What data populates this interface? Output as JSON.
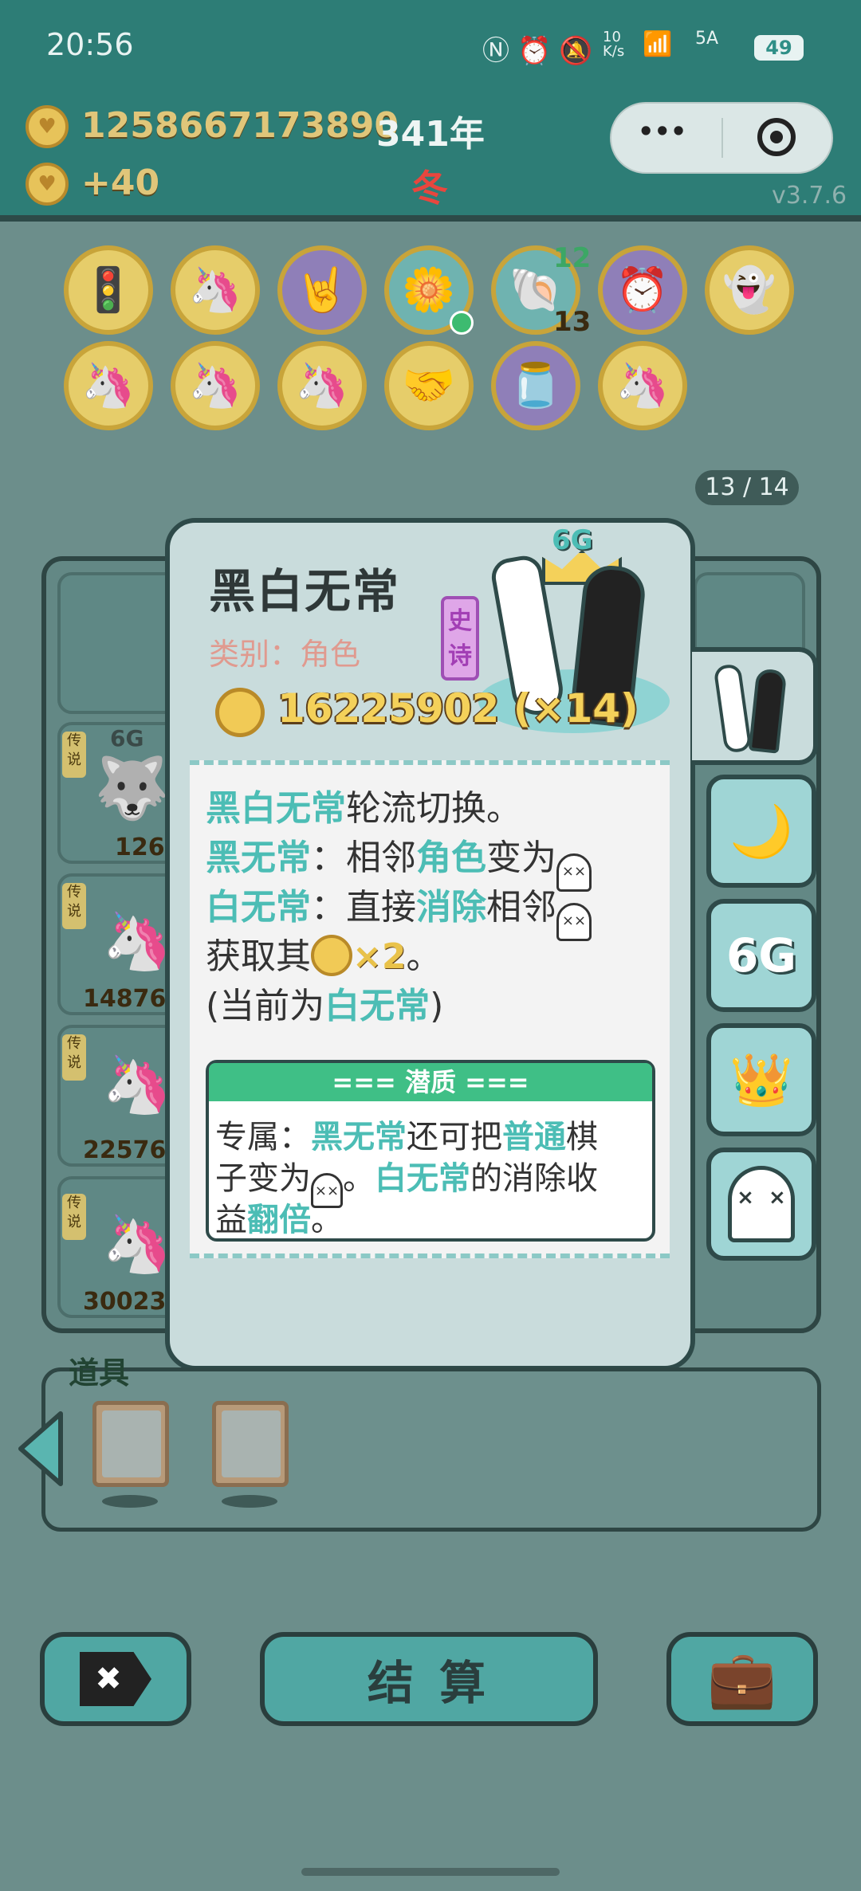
{
  "status_bar": {
    "time": "20:56",
    "net_speed": "10\nK/s",
    "signal": "5A",
    "battery": "49"
  },
  "header": {
    "coins": "1258667173890",
    "year": "341年",
    "gain": "+40",
    "season": "冬",
    "version": "v3.7.6",
    "menu_dots": "•••"
  },
  "icons_row1": [
    {
      "name": "traffic-light-ghost-icon",
      "glyph": "🚦"
    },
    {
      "name": "unicorn-icon",
      "glyph": "🦄"
    },
    {
      "name": "rock-hand-icon",
      "glyph": "🤘"
    },
    {
      "name": "flower-pot-icon",
      "glyph": "🌼"
    },
    {
      "name": "shell-icon",
      "glyph": "🐚",
      "badge_top": "12",
      "badge_bottom": "13"
    },
    {
      "name": "time-frame-icon",
      "glyph": "⏰"
    },
    {
      "name": "ghost-tongue-icon",
      "glyph": "👻"
    }
  ],
  "icons_row2": [
    {
      "name": "unicorn-icon",
      "glyph": "🦄"
    },
    {
      "name": "unicorn-icon",
      "glyph": "🦄"
    },
    {
      "name": "unicorn-icon",
      "glyph": "🦄"
    },
    {
      "name": "handshake-icon",
      "glyph": "🤝"
    },
    {
      "name": "jar-icon",
      "glyph": "🫙"
    },
    {
      "name": "unicorn-icon",
      "glyph": "🦄"
    }
  ],
  "page_counter": "13 / 14",
  "board": {
    "legend_tag": "传说",
    "tile_6g": "6G",
    "values": [
      "126",
      "14876",
      "22576",
      "30023"
    ]
  },
  "card": {
    "title": "黑白无常",
    "category": "类别：角色",
    "rarity": "史诗",
    "badge_6g": "6G",
    "price": "16225902 (×14)",
    "desc": {
      "l1_hl": "黑白无常",
      "l1_rest": "轮流切换。",
      "l2_hl": "黑无常",
      "l2_a": "：相邻",
      "l2_hl2": "角色",
      "l2_b": "变为",
      "l3_hl": "白无常",
      "l3_a": "：直接",
      "l3_hl2": "消除",
      "l3_b": "相邻",
      "l4_a": "获取其",
      "l4_b": "×2",
      "l4_c": "。",
      "l5_a": "(当前为",
      "l5_hl": "白无常",
      "l5_b": ")"
    },
    "latent": {
      "header": "=== 潜质 ===",
      "l1_a": "专属：",
      "l1_hl": "黑无常",
      "l1_b": "还可把",
      "l1_hl2": "普通",
      "l1_c": "棋",
      "l2_a": "子变为",
      "l2_b": "。",
      "l2_hl": "白无常",
      "l2_c": "的消除收",
      "l3_a": "益",
      "l3_hl": "翻倍",
      "l3_b": "。"
    }
  },
  "side_tabs": [
    {
      "name": "tab-black-white-impermanence",
      "glyph": "⚫"
    },
    {
      "name": "tab-moon",
      "glyph": "🌙"
    },
    {
      "name": "tab-6g",
      "label": "6G"
    },
    {
      "name": "tab-crown",
      "glyph": "👑"
    },
    {
      "name": "tab-ghost",
      "glyph": "×  ×"
    }
  ],
  "props": {
    "label": "道具"
  },
  "bottom": {
    "settle_label": "结 算",
    "delete_glyph": "✖",
    "bag_glyph": "💼"
  },
  "colors": {
    "accent_teal": "#4cbdb5",
    "header_teal": "#2f8f87",
    "gold": "#f4d15a"
  }
}
